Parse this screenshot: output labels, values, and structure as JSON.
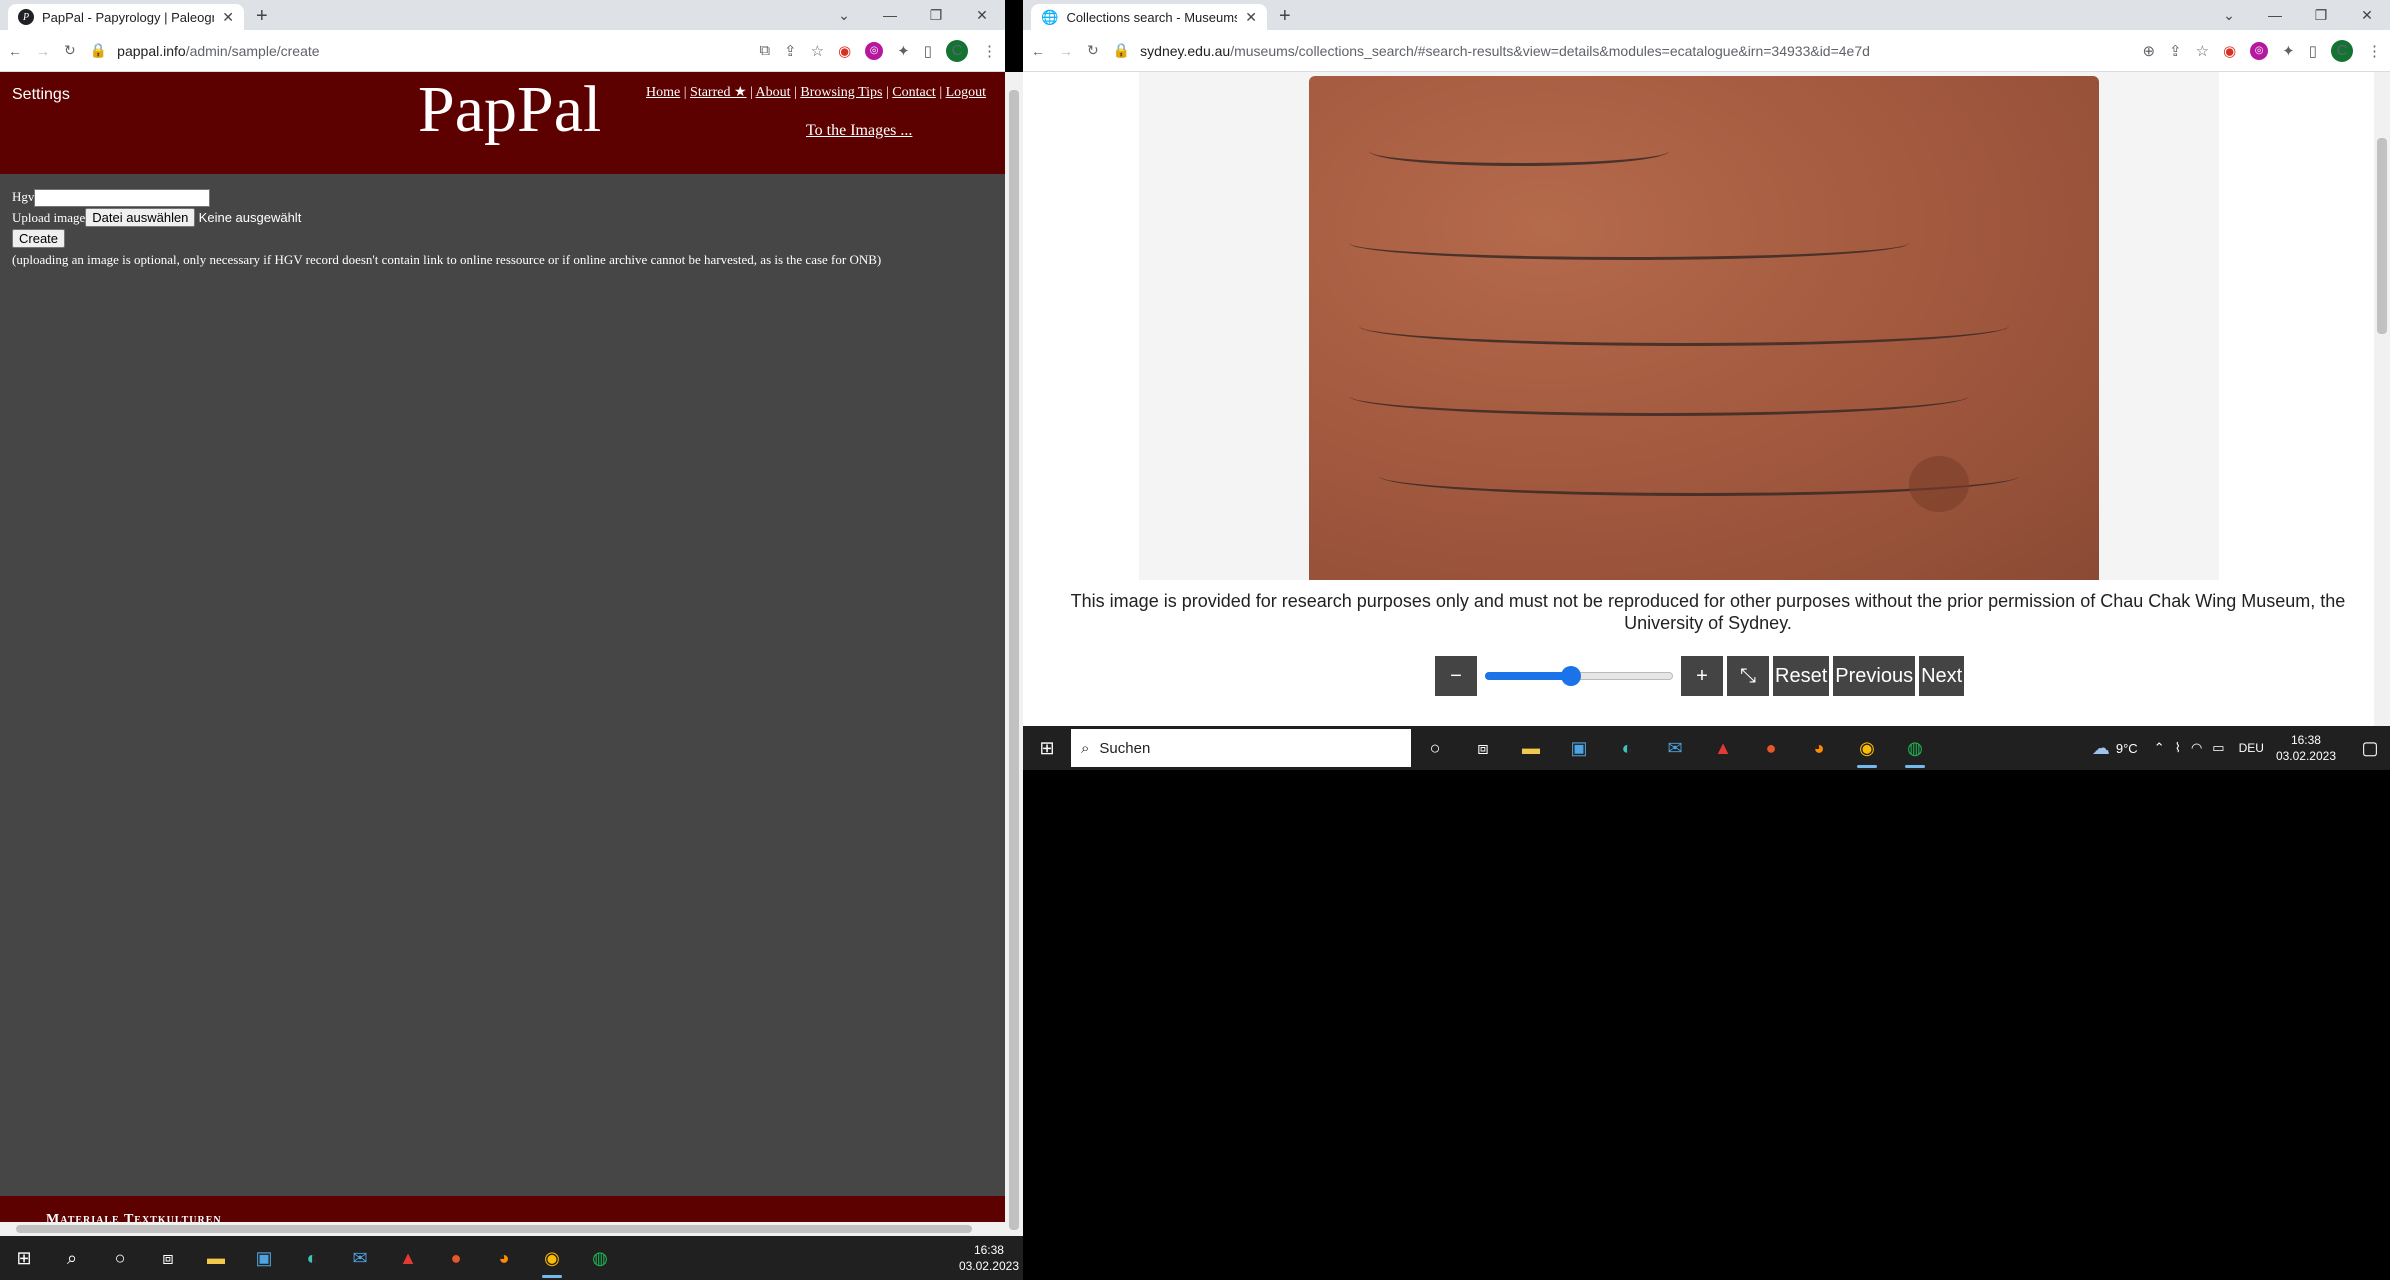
{
  "left_window": {
    "tab_title": "PapPal - Papyrology | Paleography",
    "favicon_letter": "P",
    "url_host": "pappal.info",
    "url_path": "/admin/sample/create",
    "avatar_letter": "C",
    "page": {
      "settings_label": "Settings",
      "logo": "PapPal",
      "nav": [
        "Home",
        "Starred ★",
        "About",
        "Browsing Tips",
        "Contact",
        "Logout"
      ],
      "to_images": "To the Images ...",
      "hgv_label": "Hgv",
      "upload_label": "Upload image",
      "file_button": "Datei auswählen",
      "file_status": "Keine ausgewählt",
      "create_button": "Create",
      "note": "(uploading an image is optional, only necessary if HGV record doesn't contain link to online ressource or if online archive cannot be harvested, as is the case for ONB)",
      "footer_text": "Materiale Textkulturen"
    },
    "taskbar_time": "16:38",
    "taskbar_date": "03.02.2023"
  },
  "right_window": {
    "tab_title": "Collections search - Museums - The",
    "url_host": "sydney.edu.au",
    "url_path": "/museums/collections_search/#search-results&view=details&modules=ecatalogue&irn=34933&id=4e7d",
    "avatar_letter": "C",
    "disclaimer": "This image is provided for research purposes only and must not be reproduced for other purposes without the prior permission of Chau Chak Wing Museum, the University of Sydney.",
    "zoom": {
      "minus": "−",
      "plus": "+",
      "fullscreen": "⤡",
      "reset": "Reset",
      "previous": "Previous",
      "next": "Next",
      "level": 0.45
    },
    "taskbar": {
      "search_placeholder": "Suchen",
      "weather": "9°C",
      "language": "DEU",
      "time": "16:38",
      "date": "03.02.2023"
    }
  },
  "colors": {
    "pappal_red": "#5c0000",
    "pappal_bg": "#464646",
    "slider_blue": "#1a73e8",
    "zoom_btn": "#444444"
  }
}
